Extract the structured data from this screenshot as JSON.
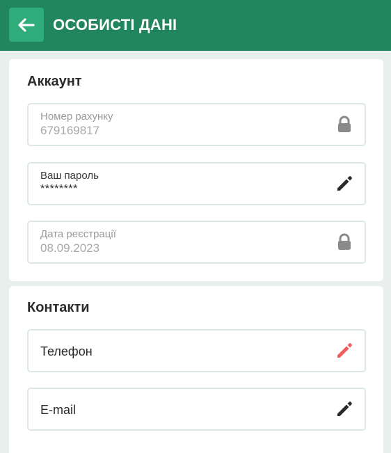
{
  "header": {
    "title": "ОСОБИСТІ ДАНІ",
    "back_icon": "arrow-left-icon",
    "background": "#21855e",
    "back_background": "#2eac79"
  },
  "account": {
    "title": "Аккаунт",
    "fields": [
      {
        "label": "Номер рахунку",
        "value": "679169817",
        "icon": "lock-icon"
      },
      {
        "label": "Ваш пароль",
        "value": "********",
        "icon": "pencil-icon"
      },
      {
        "label": "Дата реєстрації",
        "value": "08.09.2023",
        "icon": "lock-icon"
      }
    ]
  },
  "contacts": {
    "title": "Контакти",
    "fields": [
      {
        "label": "Телефон",
        "icon": "pencil-icon",
        "icon_color": "#f25c5c"
      },
      {
        "label": "E-mail",
        "icon": "pencil-icon",
        "icon_color": "#2b2b2b"
      }
    ]
  }
}
